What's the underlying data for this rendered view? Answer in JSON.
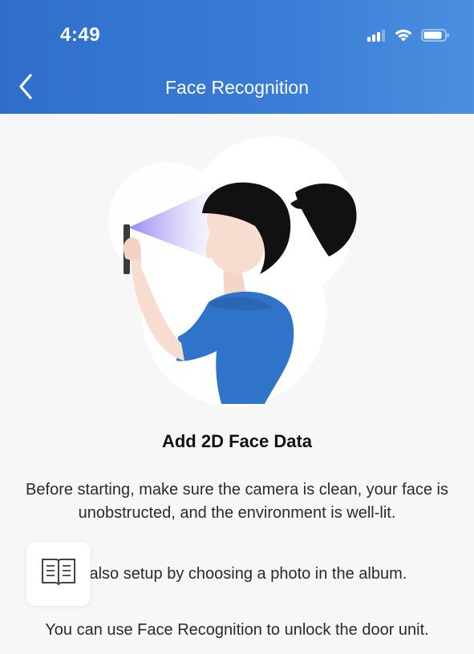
{
  "status_bar": {
    "time": "4:49"
  },
  "nav": {
    "title": "Face Recognition"
  },
  "main": {
    "heading": "Add 2D Face Data",
    "paragraphs": [
      "Before starting, make sure the camera is clean, your face is unobstructed, and the environment is well-lit.",
      "an also setup by choosing a photo in the album.",
      "You can use Face Recognition to unlock the door unit."
    ]
  },
  "icons": {
    "back": "chevron-left-icon",
    "guide": "book-icon",
    "signal": "cellular-signal-icon",
    "wifi": "wifi-icon",
    "battery": "battery-icon"
  },
  "colors": {
    "header": "#3576d0",
    "shirt": "#2f74c8",
    "hair": "#111111",
    "skin": "#f6ddd0",
    "beam": "#8f7cf0"
  }
}
